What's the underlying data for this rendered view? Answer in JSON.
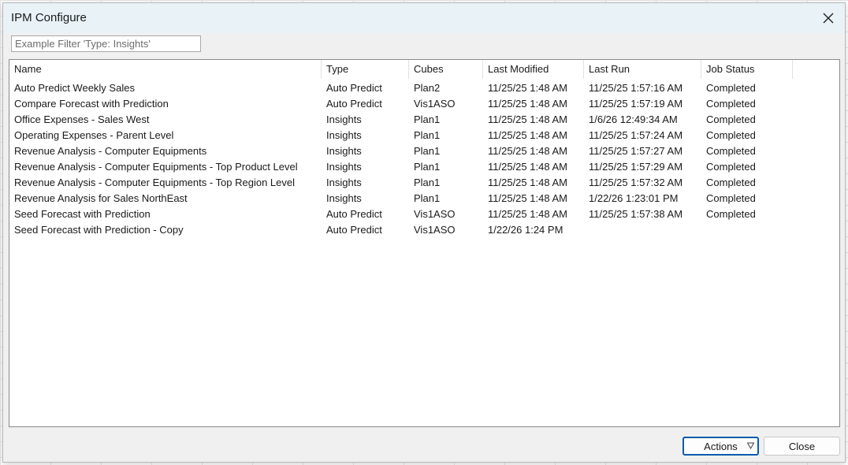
{
  "window": {
    "title": "IPM Configure"
  },
  "filter": {
    "placeholder": "Example Filter 'Type: Insights'",
    "value": ""
  },
  "table": {
    "columns": [
      "Name",
      "Type",
      "Cubes",
      "Last Modified",
      "Last Run",
      "Job Status"
    ],
    "rows": [
      [
        "Auto Predict Weekly Sales",
        "Auto Predict",
        "Plan2",
        "11/25/25 1:48 AM",
        "11/25/25 1:57:16 AM",
        "Completed"
      ],
      [
        "Compare Forecast with Prediction",
        "Auto Predict",
        "Vis1ASO",
        "11/25/25 1:48 AM",
        "11/25/25 1:57:19 AM",
        "Completed"
      ],
      [
        "Office Expenses - Sales West",
        "Insights",
        "Plan1",
        "11/25/25 1:48 AM",
        "1/6/26 12:49:34 AM",
        "Completed"
      ],
      [
        "Operating Expenses - Parent Level",
        "Insights",
        "Plan1",
        "11/25/25 1:48 AM",
        "11/25/25 1:57:24 AM",
        "Completed"
      ],
      [
        "Revenue Analysis - Computer Equipments",
        "Insights",
        "Plan1",
        "11/25/25 1:48 AM",
        "11/25/25 1:57:27 AM",
        "Completed"
      ],
      [
        "Revenue Analysis - Computer Equipments - Top Product Level",
        "Insights",
        "Plan1",
        "11/25/25 1:48 AM",
        "11/25/25 1:57:29 AM",
        "Completed"
      ],
      [
        "Revenue Analysis - Computer Equipments - Top Region Level",
        "Insights",
        "Plan1",
        "11/25/25 1:48 AM",
        "11/25/25 1:57:32 AM",
        "Completed"
      ],
      [
        "Revenue Analysis for Sales NorthEast",
        "Insights",
        "Plan1",
        "11/25/25 1:48 AM",
        "1/22/26 1:23:01 PM",
        "Completed"
      ],
      [
        "Seed Forecast with Prediction",
        "Auto Predict",
        "Vis1ASO",
        "11/25/25 1:48 AM",
        "11/25/25 1:57:38 AM",
        "Completed"
      ],
      [
        "Seed Forecast with Prediction - Copy",
        "Auto Predict",
        "Vis1ASO",
        "1/22/26 1:24 PM",
        "",
        ""
      ]
    ]
  },
  "buttons": {
    "actions": "Actions",
    "close": "Close"
  },
  "icons": {
    "close": "close-icon",
    "actions_dropdown": "chevron-down-icon"
  },
  "colors": {
    "title_bar": "#e8f2f7",
    "dialog_bg": "#f0f0f0",
    "default_button_border": "#0b5cad"
  }
}
